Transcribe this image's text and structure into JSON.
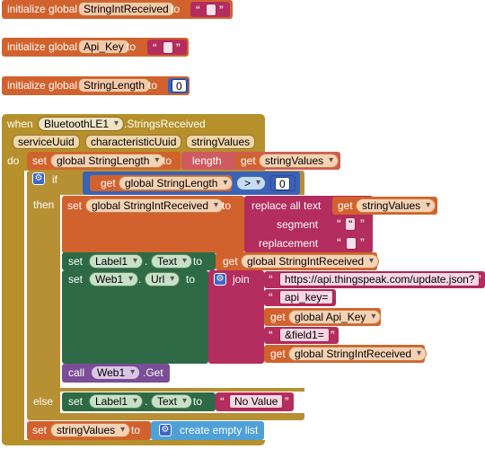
{
  "colors": {
    "variable_orange": "#d2622d",
    "text_magenta": "#b32d5e",
    "math_blue": "#3a62b7",
    "event_gold": "#b6902a",
    "component_green": "#2e6a45",
    "call_violet": "#7a4d96",
    "control_gold": "#b79034",
    "logic_blue": "#4ea0d8"
  },
  "globals": [
    {
      "init_label": "initialize global",
      "name": "StringIntReceived",
      "to": "to",
      "value": ""
    },
    {
      "init_label": "initialize global",
      "name": "Api_Key",
      "to": "to",
      "value": ""
    },
    {
      "init_label": "initialize global",
      "name": "StringLength",
      "to": "to",
      "value": "0"
    }
  ],
  "event": {
    "when": "when",
    "component": "BluetoothLE1",
    "event_name": ".StringsReceived",
    "params": [
      "serviceUuid",
      "characteristicUuid",
      "stringValues"
    ],
    "do": "do"
  },
  "set_length": {
    "set": "set",
    "var": "global StringLength",
    "to": "to",
    "fn": "length",
    "get": "get",
    "arg": "stringValues"
  },
  "if_block": {
    "if": "if",
    "get": "get",
    "var": "global StringLength",
    "op": ">",
    "value": "0",
    "then": "then",
    "else": "else"
  },
  "replace_stmt": {
    "set": "set",
    "var": "global StringIntReceived",
    "to": "to",
    "fn": "replace all text",
    "get": "get",
    "arg": "stringValues",
    "segment_label": "segment",
    "segment_value": "\"",
    "replacement_label": "replacement",
    "replacement_value": ""
  },
  "label_set": {
    "set": "set",
    "comp": "Label1",
    "dot": ".",
    "prop": "Text",
    "to": "to",
    "get": "get",
    "var": "global StringIntReceived"
  },
  "web_set": {
    "set": "set",
    "comp": "Web1",
    "dot": ".",
    "prop": "Url",
    "to": "to",
    "join": "join",
    "parts": [
      {
        "kind": "text",
        "value": "https://api.thingspeak.com/update.json?"
      },
      {
        "kind": "text",
        "value": "api_key="
      },
      {
        "kind": "get",
        "get": "get",
        "value": "global Api_Key"
      },
      {
        "kind": "text",
        "value": "&field1="
      },
      {
        "kind": "get",
        "get": "get",
        "value": "global StringIntReceived"
      }
    ]
  },
  "call_get": {
    "call": "call",
    "comp": "Web1",
    "method": ".Get"
  },
  "else_set": {
    "set": "set",
    "comp": "Label1",
    "dot": ".",
    "prop": "Text",
    "to": "to",
    "value": "No Value"
  },
  "final_set": {
    "set": "set",
    "var": "stringValues",
    "to": "to",
    "fn": "create empty list"
  }
}
